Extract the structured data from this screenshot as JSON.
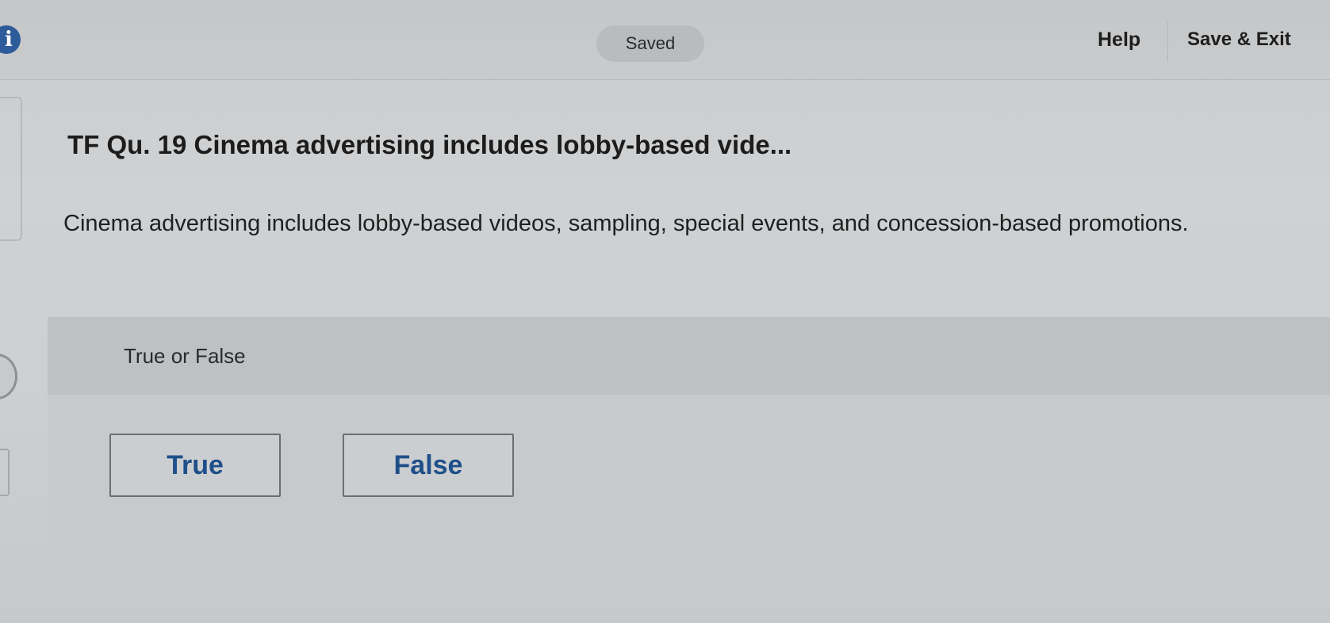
{
  "header": {
    "status_label": "Saved",
    "help_label": "Help",
    "save_exit_label": "Save & Exit",
    "info_icon": "info-icon"
  },
  "question": {
    "title": "TF Qu. 19 Cinema advertising includes lobby-based vide...",
    "prompt": "Cinema advertising includes lobby-based videos, sampling, special events, and concession-based promotions."
  },
  "answer": {
    "type_label": "True or False",
    "choices": [
      "True",
      "False"
    ]
  },
  "colors": {
    "accent": "#1f4f8a",
    "info_icon": "#2e5b9a"
  }
}
